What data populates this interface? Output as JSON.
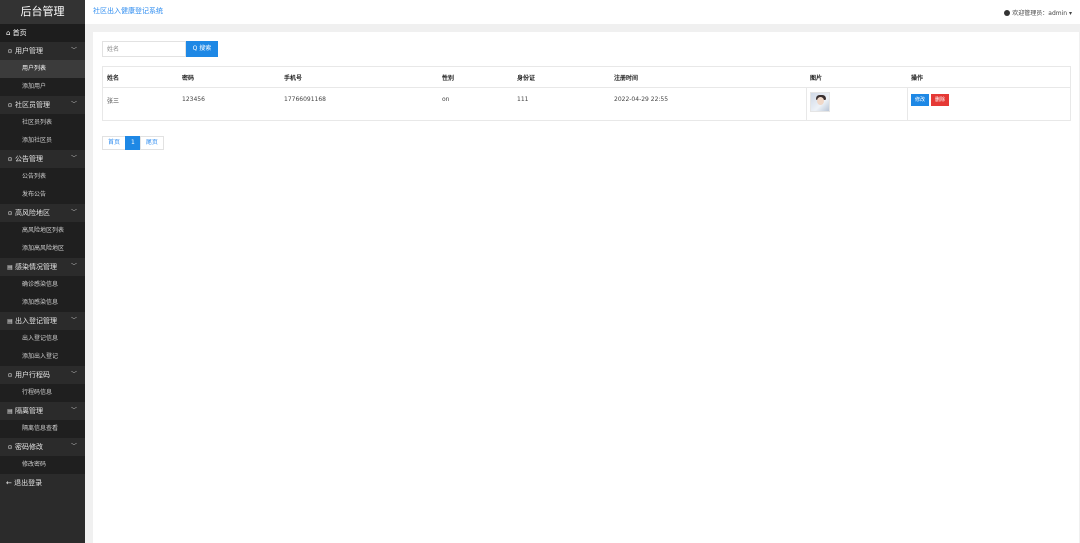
{
  "app": {
    "logo": "后台管理",
    "system_title": "社区出入健康登记系统"
  },
  "header": {
    "welcome": "欢迎管理员：admin ▾"
  },
  "sidebar": {
    "home": "⌂ 首页",
    "groups": [
      {
        "icon": "⊙",
        "label": "用户管理",
        "items": [
          "用户列表",
          "添加用户"
        ]
      },
      {
        "icon": "⊙",
        "label": "社区员管理",
        "items": [
          "社区员列表",
          "添加社区员"
        ]
      },
      {
        "icon": "⊙",
        "label": "公告管理",
        "items": [
          "公告列表",
          "发布公告"
        ]
      },
      {
        "icon": "⊙",
        "label": "高风险地区",
        "items": [
          "高风险地区列表",
          "添加高风险地区"
        ]
      },
      {
        "icon": "▤",
        "label": "感染情况管理",
        "items": [
          "确诊感染信息",
          "添加感染信息"
        ]
      },
      {
        "icon": "▤",
        "label": "出入登记管理",
        "items": [
          "出入登记信息",
          "添加出入登记"
        ]
      },
      {
        "icon": "⊙",
        "label": "用户行程码",
        "items": [
          "行程码信息"
        ]
      },
      {
        "icon": "▤",
        "label": "隔离管理",
        "items": [
          "隔离信息查看"
        ]
      },
      {
        "icon": "⊙",
        "label": "密码修改",
        "items": [
          "修改密码"
        ]
      }
    ],
    "logout": "← 退出登录"
  },
  "search": {
    "placeholder": "姓名",
    "button": "Q 搜索"
  },
  "table": {
    "headers": [
      "姓名",
      "密码",
      "手机号",
      "性别",
      "身份证",
      "注册时间",
      "图片",
      "操作"
    ],
    "rows": [
      {
        "name": "张三",
        "password": "123456",
        "phone": "17766091168",
        "gender": "on",
        "idcard": "111",
        "reg_time": "2022-04-29 22:55",
        "edit": "修改",
        "delete": "删除"
      }
    ]
  },
  "pager": {
    "first": "首页",
    "current": "1",
    "last": "尾页"
  }
}
